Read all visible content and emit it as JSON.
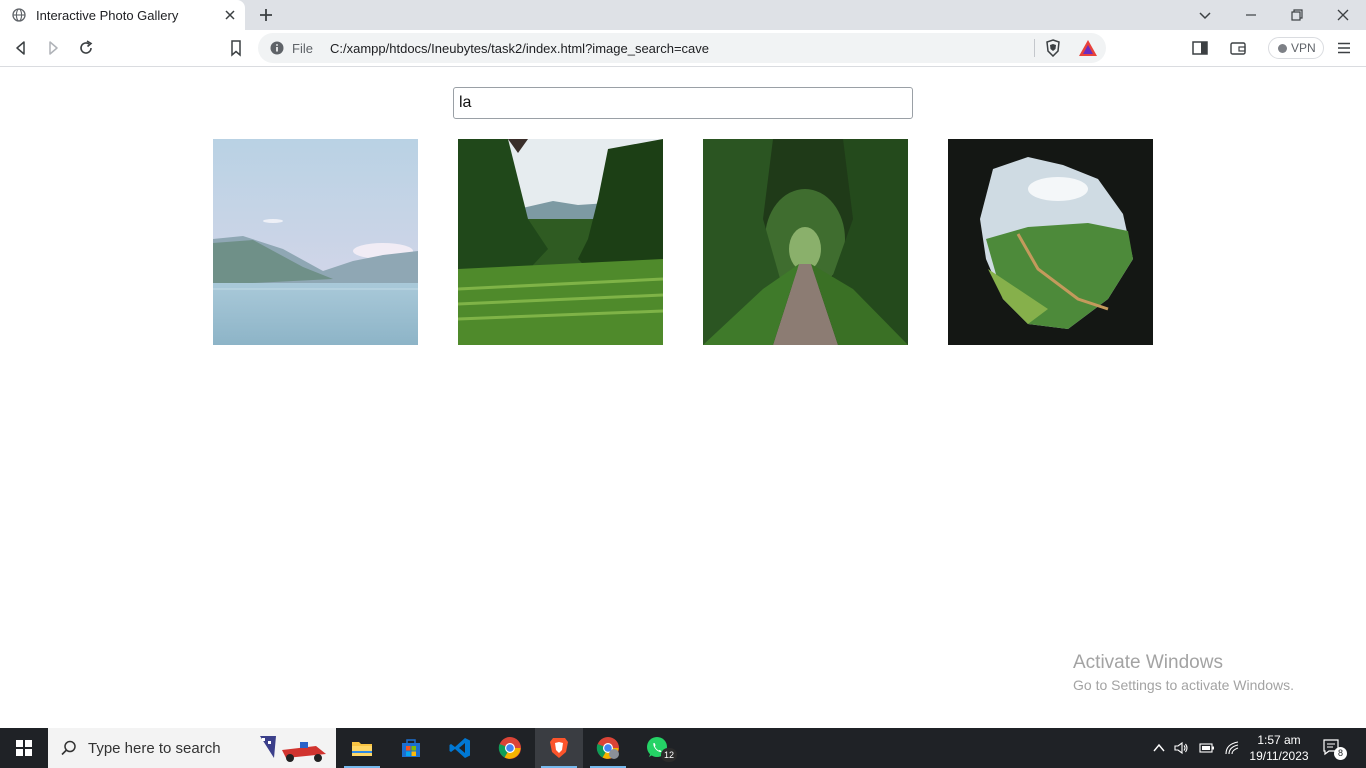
{
  "browser": {
    "tab_title": "Interactive Photo Gallery",
    "omnibox_file_label": "File",
    "url": "C:/xampp/htdocs/Ineubytes/task2/index.html?image_search=cave",
    "vpn_label": "VPN"
  },
  "page": {
    "search_value": "la",
    "images": [
      {
        "name": "lake-mountains"
      },
      {
        "name": "green-valley"
      },
      {
        "name": "forest-path"
      },
      {
        "name": "cave-view"
      }
    ]
  },
  "watermark": {
    "line1": "Activate Windows",
    "line2": "Go to Settings to activate Windows."
  },
  "taskbar": {
    "search_placeholder": "Type here to search",
    "whatsapp_badge": "12",
    "time": "1:57 am",
    "date": "19/11/2023",
    "notification_count": "8"
  },
  "colors": {
    "tab_strip": "#dee1e6",
    "taskbar": "#1f2226",
    "brave_orange": "#fb542b",
    "vscode_blue": "#0078d4",
    "whatsapp_green": "#25d366"
  }
}
